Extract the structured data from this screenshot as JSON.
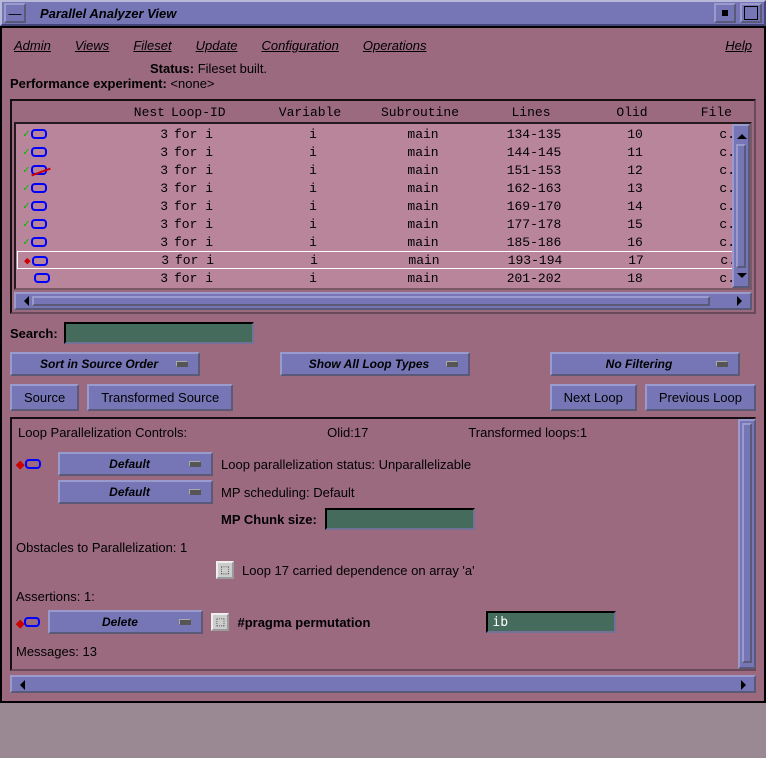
{
  "window": {
    "title": "Parallel Analyzer View"
  },
  "menu": {
    "admin": "Admin",
    "views": "Views",
    "fileset": "Fileset",
    "update": "Update",
    "configuration": "Configuration",
    "operations": "Operations",
    "help": "Help"
  },
  "status": {
    "status_label": "Status:",
    "status_value": "Fileset built.",
    "perf_label": "Performance experiment:",
    "perf_value": "<none>"
  },
  "table": {
    "headers": {
      "nest": "Nest",
      "loop_id": "Loop-ID",
      "variable": "Variable",
      "subroutine": "Subroutine",
      "lines": "Lines",
      "olid": "Olid",
      "file": "File"
    },
    "rows": [
      {
        "nest": "3",
        "loop_id": "for i",
        "variable": "i",
        "subroutine": "main",
        "lines": "134-135",
        "olid": "10",
        "file": "c."
      },
      {
        "nest": "3",
        "loop_id": "for i",
        "variable": "i",
        "subroutine": "main",
        "lines": "144-145",
        "olid": "11",
        "file": "c."
      },
      {
        "nest": "3",
        "loop_id": "for i",
        "variable": "i",
        "subroutine": "main",
        "lines": "151-153",
        "olid": "12",
        "file": "c."
      },
      {
        "nest": "3",
        "loop_id": "for i",
        "variable": "i",
        "subroutine": "main",
        "lines": "162-163",
        "olid": "13",
        "file": "c."
      },
      {
        "nest": "3",
        "loop_id": "for i",
        "variable": "i",
        "subroutine": "main",
        "lines": "169-170",
        "olid": "14",
        "file": "c."
      },
      {
        "nest": "3",
        "loop_id": "for i",
        "variable": "i",
        "subroutine": "main",
        "lines": "177-178",
        "olid": "15",
        "file": "c."
      },
      {
        "nest": "3",
        "loop_id": "for i",
        "variable": "i",
        "subroutine": "main",
        "lines": "185-186",
        "olid": "16",
        "file": "c."
      },
      {
        "nest": "3",
        "loop_id": "for i",
        "variable": "i",
        "subroutine": "main",
        "lines": "193-194",
        "olid": "17",
        "file": "c."
      },
      {
        "nest": "3",
        "loop_id": "for i",
        "variable": "i",
        "subroutine": "main",
        "lines": "201-202",
        "olid": "18",
        "file": "c."
      }
    ],
    "selected_index": 7
  },
  "search": {
    "label": "Search:"
  },
  "filters": {
    "sort": "Sort in Source Order",
    "show": "Show All Loop Types",
    "filter": "No Filtering"
  },
  "buttons": {
    "source": "Source",
    "transformed_source": "Transformed Source",
    "next_loop": "Next Loop",
    "previous_loop": "Previous Loop"
  },
  "details": {
    "section_label": "Loop Parallelization Controls:",
    "olid_label": "Olid:17",
    "trans_label": "Transformed loops:1",
    "par_status_opt": "Default",
    "par_status_lbl": "Loop parallelization status:",
    "par_status_val": "Unparallelizable",
    "sched_opt": "Default",
    "sched_lbl": "MP scheduling:",
    "sched_val": "Default",
    "chunk_lbl": "MP Chunk size:",
    "obstacles_lbl": "Obstacles to Parallelization:",
    "obstacles_count": "1",
    "obstacle_text": "Loop 17 carried dependence on array 'a'",
    "assertions_lbl": "Assertions:",
    "assertions_count": "1:",
    "delete_opt": "Delete",
    "pragma_text": "#pragma permutation",
    "pragma_val": "ib",
    "messages_lbl": "Messages:",
    "messages_count": "13"
  }
}
